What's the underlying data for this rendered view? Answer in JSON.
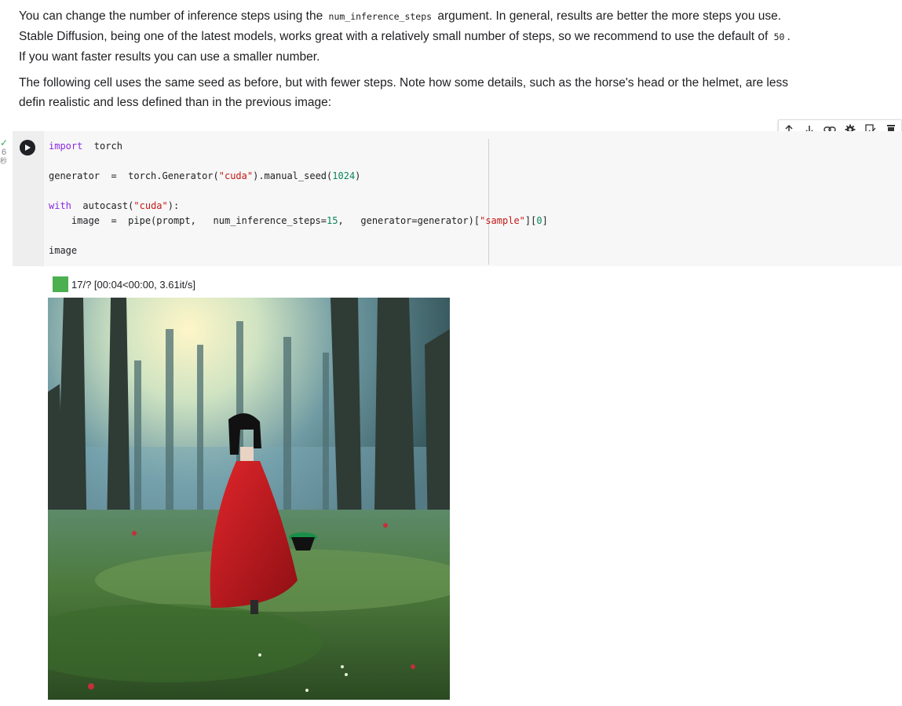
{
  "markdown": {
    "p1_part1": "You can change the number of inference steps using the ",
    "p1_code": "num_inference_steps",
    "p1_part2": " argument. In general, results are better the more steps you use.",
    "p1_line2": "Stable Diffusion, being one of the latest models, works great with a relatively small number of steps, so we recommend to use the default of ",
    "p1_code2": "50",
    "p1_line2_end": ".",
    "p1_line3": "If you want faster results you can use a smaller number.",
    "p2_line1": "The following cell uses the same seed as before, but with fewer steps. Note how some details, such as the horse's head or the helmet, are less",
    "p2_line2": "defin realistic and less defined than in the previous image:"
  },
  "toolbar": {
    "items": [
      {
        "icon": "arrow-up-icon",
        "glyph": "↑"
      },
      {
        "icon": "arrow-down-icon",
        "glyph": "↓"
      },
      {
        "icon": "link-icon",
        "glyph": "⊖"
      },
      {
        "icon": "gear-icon",
        "glyph": "✲"
      },
      {
        "icon": "mirror-cell-icon",
        "glyph": "⧉"
      },
      {
        "icon": "trash-icon",
        "glyph": "▮"
      }
    ]
  },
  "cell": {
    "status_icon": "check-icon",
    "exec_count": "6",
    "exec_time": "秒",
    "code": {
      "l1_kw": "import",
      "l1_rest": "  torch",
      "l3": "generator  =  torch.Generator(",
      "l3_str": "\"cuda\"",
      "l3_mid": ").manual_seed(",
      "l3_num": "1024",
      "l3_end": ")",
      "l5_kw": "with",
      "l5_rest": "  autocast(",
      "l5_str": "\"cuda\"",
      "l5_end": "):",
      "l6_a": "    image  =  pipe(prompt,   num_inference_steps=",
      "l6_num": "15",
      "l6_b": ",   generator=generator)[",
      "l6_str": "\"sample\"",
      "l6_c": "][",
      "l6_num2": "0",
      "l6_d": "]",
      "l8": "image"
    }
  },
  "output": {
    "progress_fraction": 1.0,
    "progress_text": "17/? [00:04<00:00, 3.61it/s]",
    "image_description_icon": "generated-image",
    "colors": {
      "progress": "#4caf50",
      "cape": "#c8161d",
      "forest": "#3f6b3a"
    }
  }
}
